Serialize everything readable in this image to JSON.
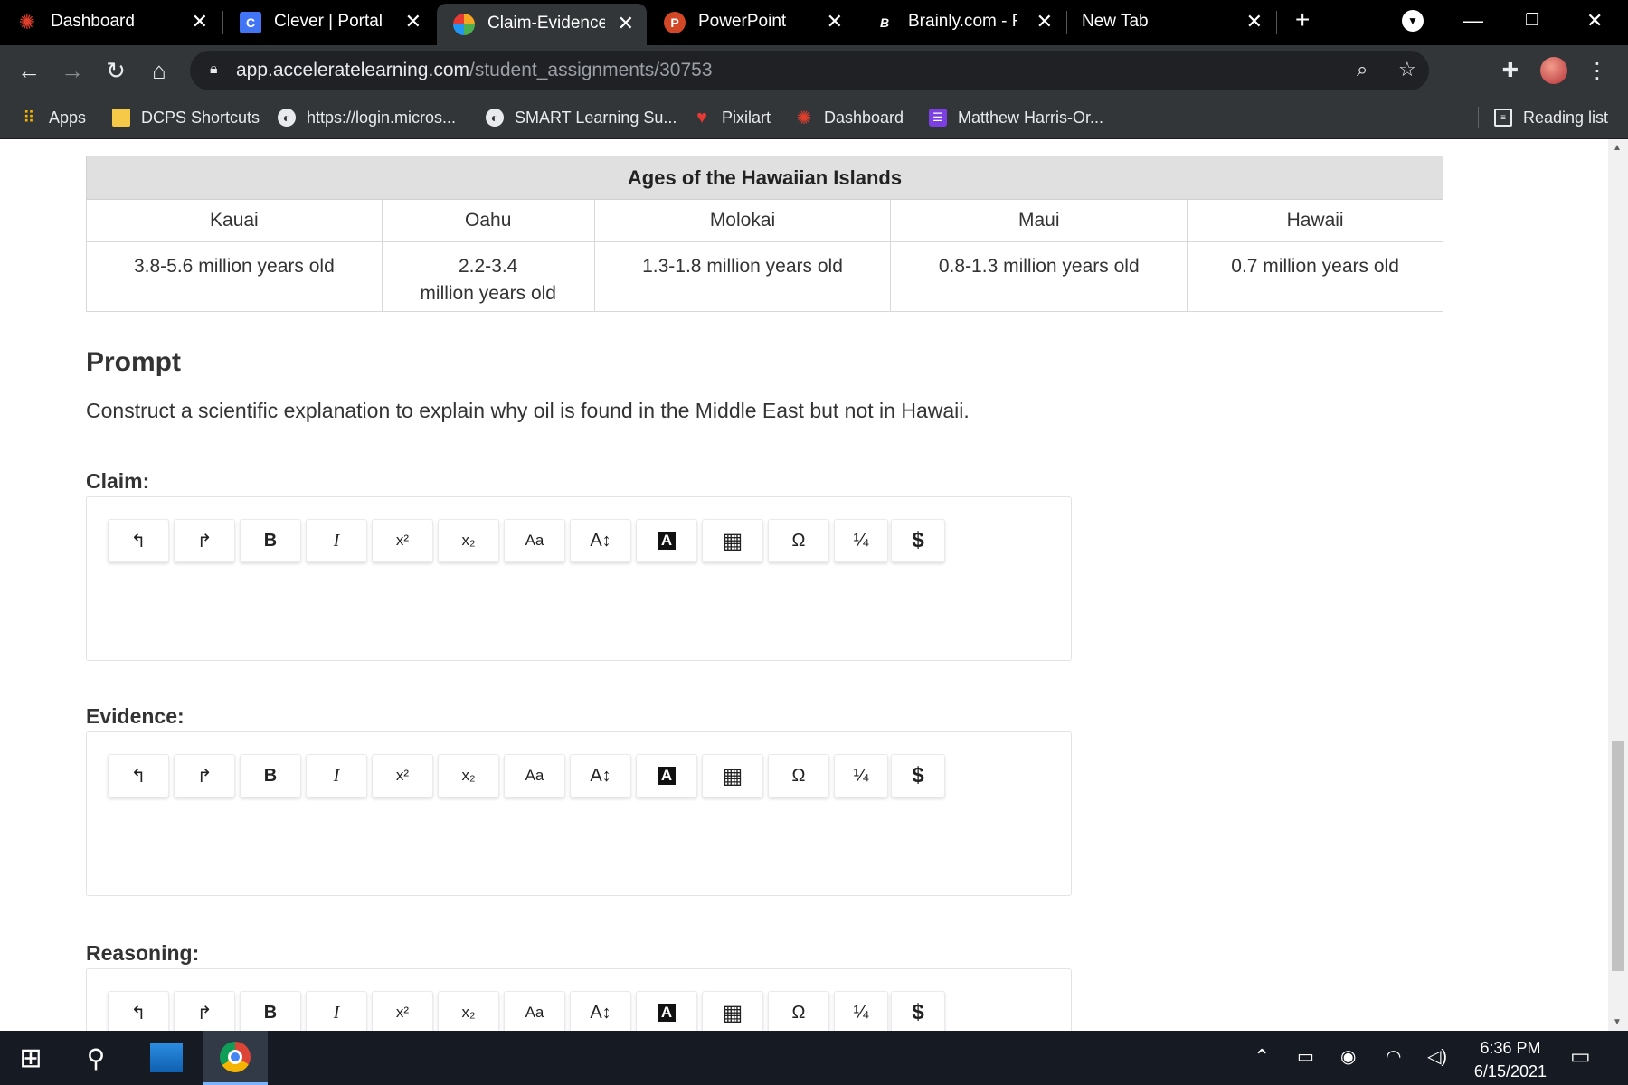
{
  "browser": {
    "tabs": [
      {
        "title": "Dashboard",
        "icon": "canvas-icon",
        "color": "#e03e2d"
      },
      {
        "title": "Clever | Portal",
        "icon": "clever-icon",
        "glyph": "C",
        "color": "#4274f6"
      },
      {
        "title": "Claim-Evidence-R",
        "icon": "accelerate-learning-icon",
        "color": "#f5a623"
      },
      {
        "title": "PowerPoint",
        "icon": "powerpoint-icon",
        "glyph": "P",
        "color": "#d24726"
      },
      {
        "title": "Brainly.com - For",
        "icon": "brainly-icon",
        "glyph": "B",
        "color": "#000000"
      },
      {
        "title": "New Tab",
        "icon": "new-tab-icon"
      }
    ],
    "url_domain": "app.acceleratelearning.com",
    "url_path": "/student_assignments/30753",
    "bookmarks": [
      {
        "label": "Apps",
        "icon": "apps-grid-icon"
      },
      {
        "label": "DCPS Shortcuts",
        "icon": "folder-icon"
      },
      {
        "label": "https://login.micros...",
        "icon": "globe-icon"
      },
      {
        "label": "SMART Learning Su...",
        "icon": "globe-icon"
      },
      {
        "label": "Pixilart",
        "icon": "heart-icon"
      },
      {
        "label": "Dashboard",
        "icon": "canvas-icon"
      },
      {
        "label": "Matthew Harris-Or...",
        "icon": "list-icon"
      }
    ],
    "reading_list": "Reading list"
  },
  "table": {
    "caption": "Ages of the Hawaiian Islands",
    "islands": [
      "Kauai",
      "Oahu",
      "Molokai",
      "Maui",
      "Hawaii"
    ],
    "ages": [
      "3.8-5.6 million years old",
      "2.2-3.4",
      "1.3-1.8 million years old",
      "0.8-1.3 million years old",
      "0.7 million years old"
    ],
    "oahu_age_line2": "million years old"
  },
  "prompt": {
    "heading": "Prompt",
    "text": "Construct a scientific explanation to explain why oil is found in the Middle East but not in Hawaii."
  },
  "sections": {
    "claim": "Claim:",
    "evidence": "Evidence:",
    "reasoning": "Reasoning:"
  },
  "editor_tools": [
    {
      "name": "undo",
      "glyph": "↰"
    },
    {
      "name": "redo",
      "glyph": "↱"
    },
    {
      "name": "bold",
      "glyph": "B"
    },
    {
      "name": "italic",
      "glyph": "I"
    },
    {
      "name": "superscript",
      "glyph": "x²"
    },
    {
      "name": "subscript",
      "glyph": "x₂"
    },
    {
      "name": "font-size",
      "glyph": "Aa"
    },
    {
      "name": "line-height",
      "glyph": "A↕"
    },
    {
      "name": "text-color",
      "glyph": "A"
    },
    {
      "name": "table",
      "glyph": "▦"
    },
    {
      "name": "special-characters",
      "glyph": "Ω"
    },
    {
      "name": "fraction",
      "glyph": "¼"
    },
    {
      "name": "math",
      "glyph": "$"
    }
  ],
  "taskbar": {
    "time": "6:36 PM",
    "date": "6/15/2021"
  }
}
